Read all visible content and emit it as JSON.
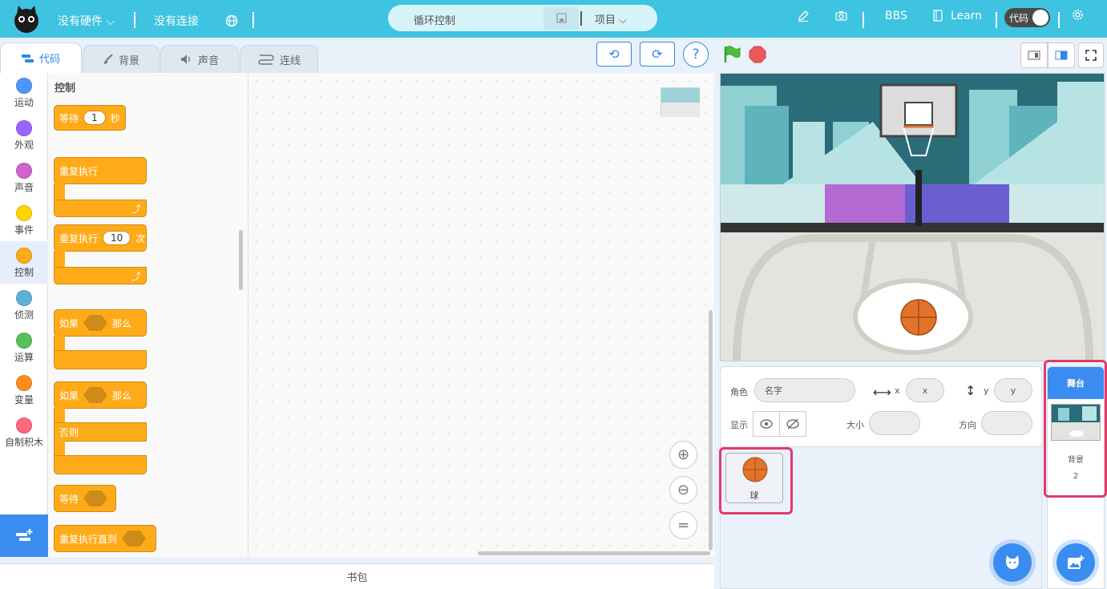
{
  "topbar": {
    "hardware_label": "没有硬件",
    "connection_label": "没有连接",
    "project_title": "循环控制",
    "project_menu": "项目",
    "bbs": "BBS",
    "learn": "Learn",
    "mode_toggle": "代码"
  },
  "tabs": [
    {
      "label": "代码",
      "icon": "blocks-icon"
    },
    {
      "label": "背景",
      "icon": "brush-icon"
    },
    {
      "label": "声音",
      "icon": "speaker-icon"
    },
    {
      "label": "连线",
      "icon": "wire-icon"
    }
  ],
  "categories": [
    {
      "label": "运动",
      "color": "#4c97ff"
    },
    {
      "label": "外观",
      "color": "#9966ff"
    },
    {
      "label": "声音",
      "color": "#cf63cf"
    },
    {
      "label": "事件",
      "color": "#ffd500"
    },
    {
      "label": "控制",
      "color": "#ffab19"
    },
    {
      "label": "侦测",
      "color": "#5cb1d6"
    },
    {
      "label": "运算",
      "color": "#59c059"
    },
    {
      "label": "变量",
      "color": "#ff8c1a"
    },
    {
      "label": "自制积木",
      "color": "#ff6680"
    }
  ],
  "palette": {
    "heading": "控制",
    "wait": {
      "label": "等待",
      "value": "1",
      "unit": "秒"
    },
    "forever": "重复执行",
    "repeat": {
      "label": "重复执行",
      "value": "10",
      "unit": "次"
    },
    "if_then": {
      "if": "如果",
      "then": "那么"
    },
    "if_else": {
      "if": "如果",
      "then": "那么",
      "else": "否则"
    },
    "wait_until": "等待",
    "repeat_until": "重复执行直到"
  },
  "backpack": "书包",
  "sprite_info": {
    "sprite_label": "角色",
    "name_placeholder": "名字",
    "x_label": "x",
    "x_placeholder": "x",
    "y_label": "y",
    "y_placeholder": "y",
    "show_label": "显示",
    "size_label": "大小",
    "direction_label": "方向"
  },
  "sprites": [
    {
      "name": "球"
    }
  ],
  "stage_panel": {
    "header": "舞台",
    "backdrop_label": "背景",
    "backdrop_count": "2"
  },
  "colors": {
    "topbar": "#3ec3e0",
    "accent": "#2f87e8",
    "control_block": "#ffab19",
    "highlight": "#e33a6a"
  }
}
